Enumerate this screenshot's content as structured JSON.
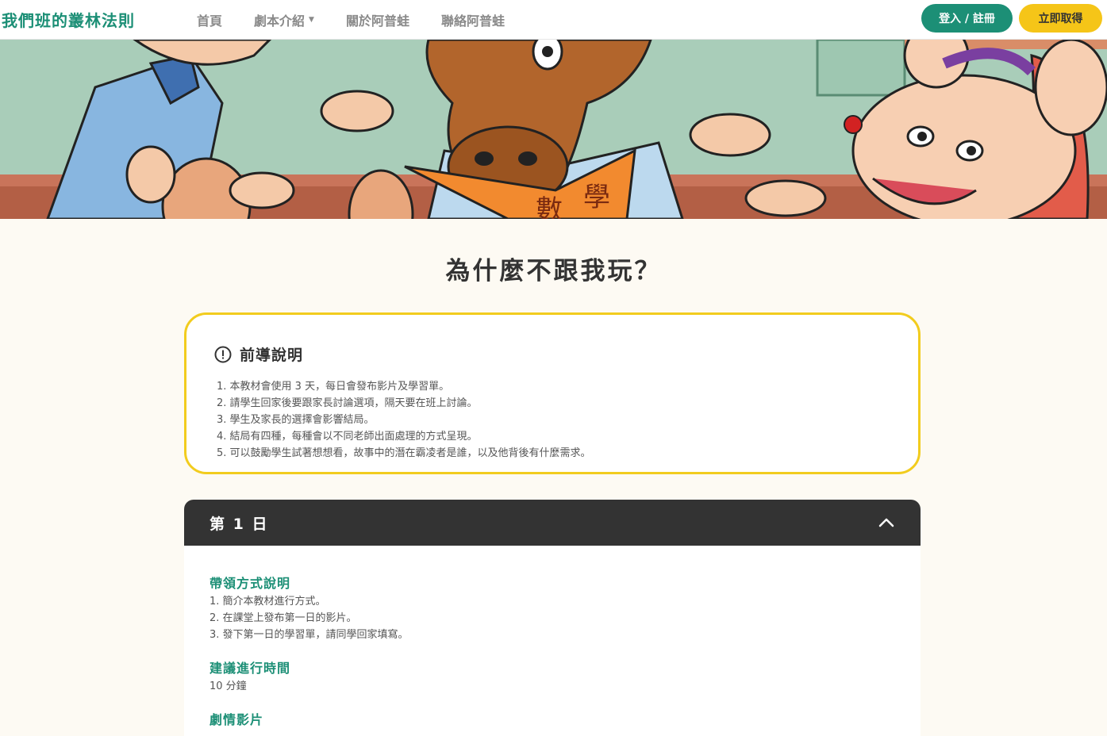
{
  "header": {
    "logo": "我們班的叢林法則",
    "nav": [
      {
        "label": "首頁",
        "has_dropdown": false
      },
      {
        "label": "劇本介紹",
        "has_dropdown": true
      },
      {
        "label": "關於阿普蛙",
        "has_dropdown": false
      },
      {
        "label": "聯絡阿普蛙",
        "has_dropdown": false
      }
    ],
    "login_label": "登入 / 註冊",
    "get_label": "立即取得"
  },
  "hero": {
    "book_text_1": "數",
    "book_text_2": "學"
  },
  "main": {
    "title": "為什麼不跟我玩？",
    "intro": {
      "title": "前導說明",
      "items": [
        "1. 本教材會使用 3 天，每日會發布影片及學習單。",
        "2. 請學生回家後要跟家長討論選項，隔天要在班上討論。",
        "3. 學生及家長的選擇會影響結局。",
        "4. 結局有四種，每種會以不同老師出面處理的方式呈現。",
        "5. 可以鼓勵學生試著想想看，故事中的潛在霸凌者是誰，以及他背後有什麼需求。"
      ]
    },
    "day": {
      "label": "第 1 日",
      "sections": [
        {
          "title": "帶領方式說明",
          "lines": [
            "1. 簡介本教材進行方式。",
            "2. 在課堂上發布第一日的影片。",
            "3. 發下第一日的學習單，請同學回家填寫。"
          ]
        },
        {
          "title": "建議進行時間",
          "lines": [
            "10 分鐘"
          ]
        },
        {
          "title": "劇情影片",
          "lines": []
        }
      ]
    }
  },
  "colors": {
    "brand_green": "#1c8f76",
    "accent_yellow": "#f5c518",
    "card_border": "#f2cc1e",
    "dark_bar": "#333333",
    "page_bg": "#fdfaf3"
  }
}
